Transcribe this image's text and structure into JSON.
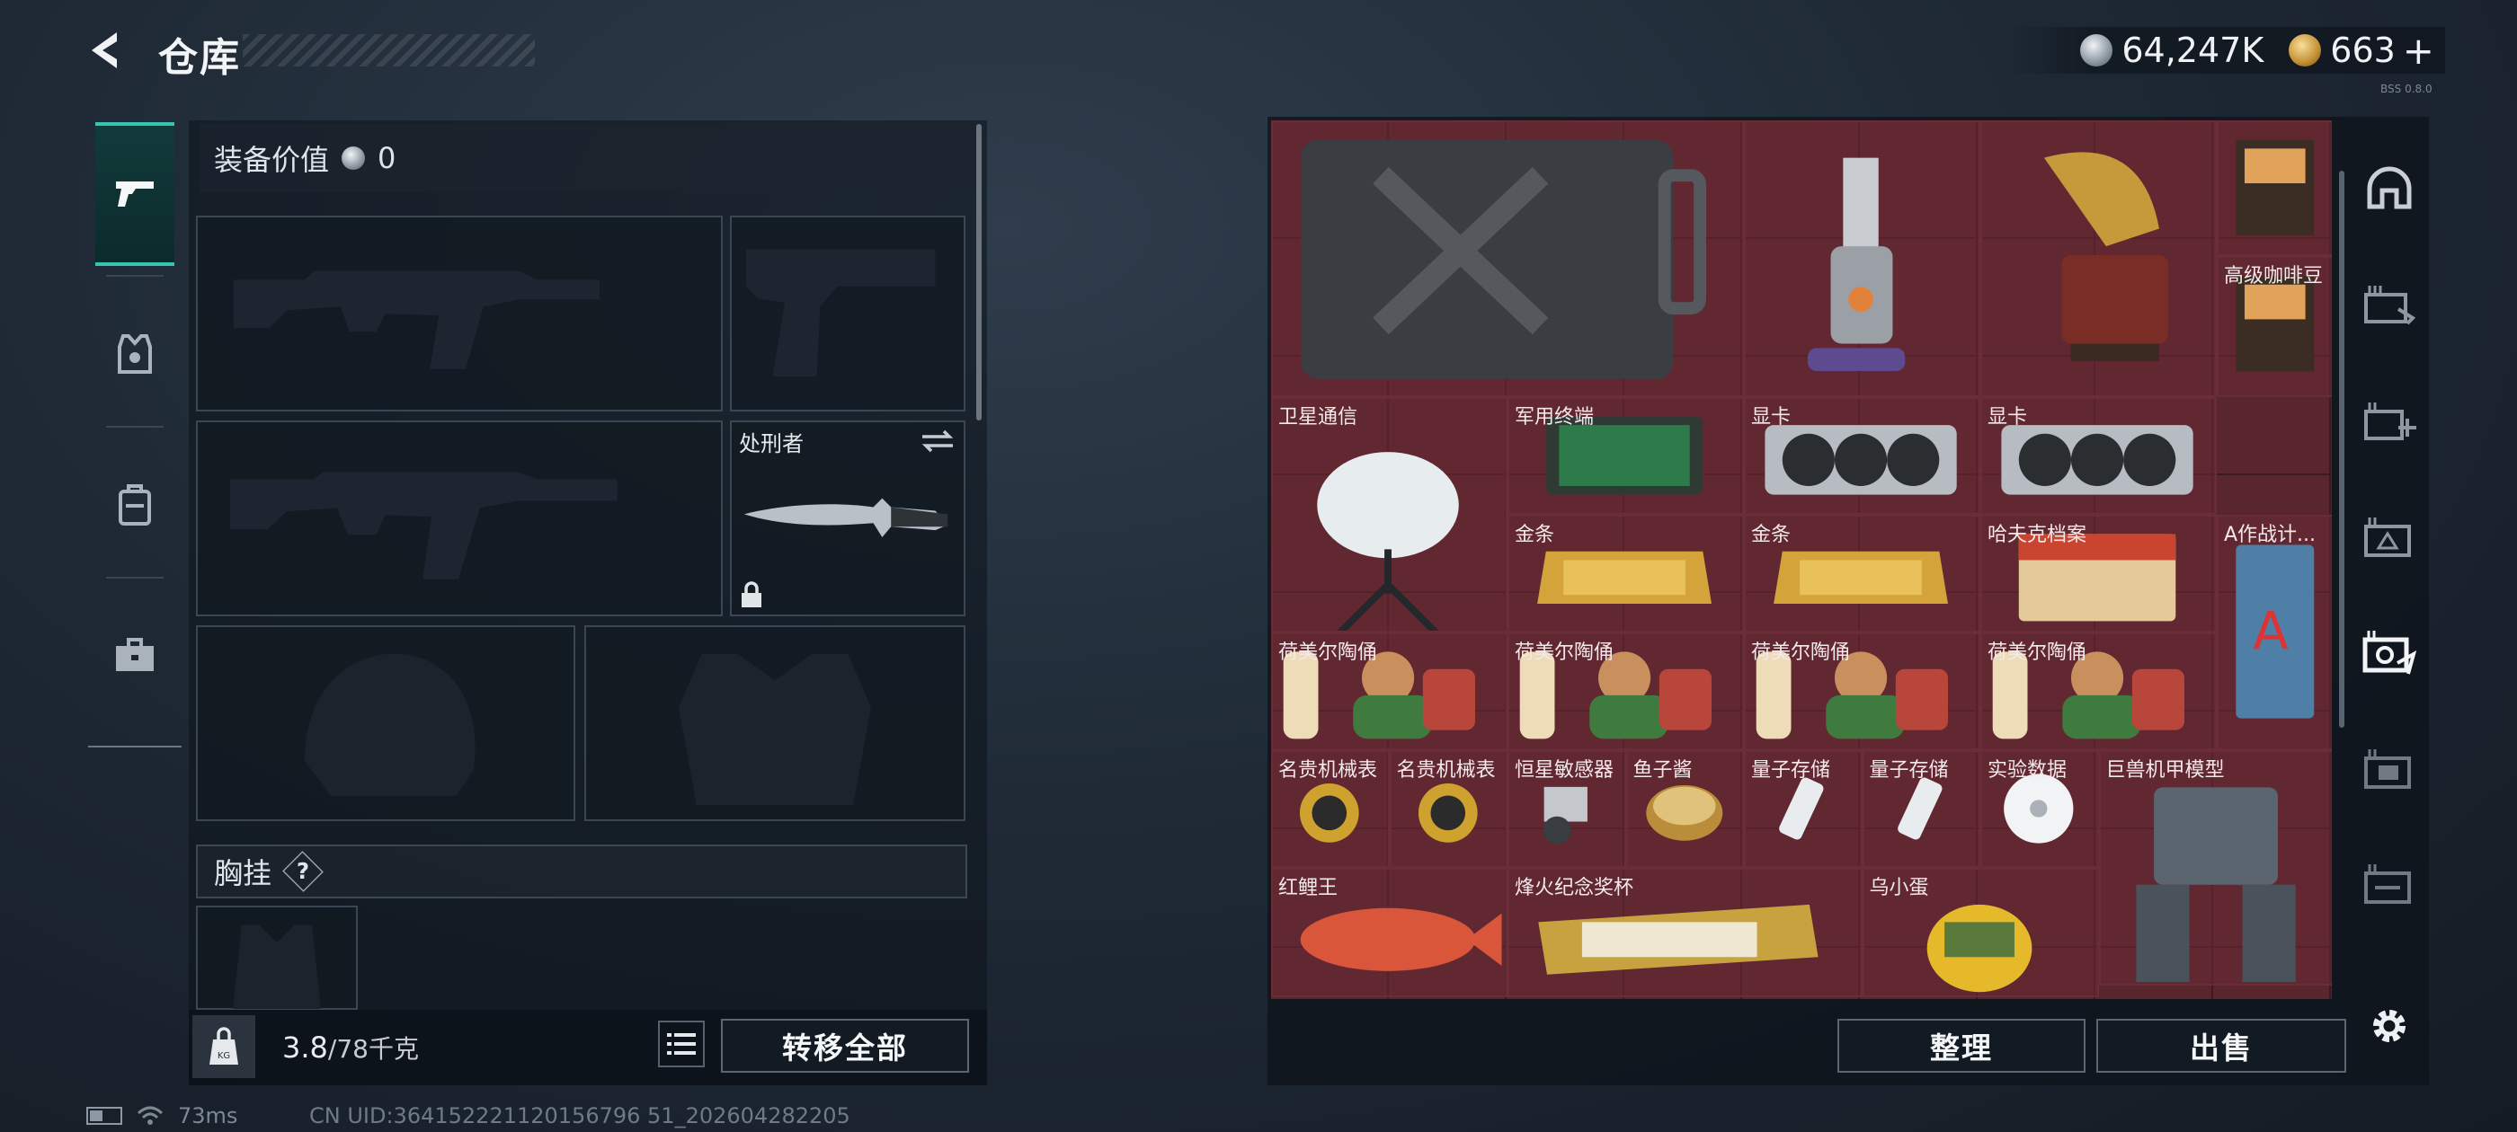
{
  "header": {
    "title": "仓库",
    "back_icon": "back-arrow-icon"
  },
  "currency": {
    "silver": "64,247K",
    "gold": "663",
    "plus": "+",
    "tiny": "BSS 0.8.0"
  },
  "left_nav": {
    "tabs": [
      {
        "icon": "pistol-icon",
        "active": true
      },
      {
        "icon": "armor-vest-icon"
      },
      {
        "icon": "backpack-icon"
      },
      {
        "icon": "briefcase-icon"
      }
    ]
  },
  "equipment": {
    "value_label": "装备价值",
    "value": "0",
    "slots": {
      "melee_label": "处刑者"
    },
    "chest_rig_label": "胸挂",
    "chest_rig_help": "?"
  },
  "footer_left": {
    "weight": "3.8",
    "capacity": "/78千克",
    "transfer_all": "转移全部"
  },
  "status": {
    "latency": "73ms",
    "uid": "CN UID:364152221120156796 51_202604282205"
  },
  "stash": {
    "items": [
      {
        "name": "",
        "icon": "jerrycan-icon"
      },
      {
        "name": "",
        "icon": "vacuum-icon"
      },
      {
        "name": "",
        "icon": "gramophone-icon"
      },
      {
        "name": "",
        "icon": "coffee-bag-icon"
      },
      {
        "name": "高级咖啡豆",
        "icon": "coffee-bag-icon"
      },
      {
        "name": "卫星通信",
        "icon": "satellite-dish-icon"
      },
      {
        "name": "军用终端",
        "icon": "circuit-board-icon"
      },
      {
        "name": "显卡",
        "icon": "gpu-icon"
      },
      {
        "name": "显卡",
        "icon": "gpu-icon"
      },
      {
        "name": "金条",
        "icon": "gold-bar-icon"
      },
      {
        "name": "金条",
        "icon": "gold-bar-icon"
      },
      {
        "name": "哈夫克档案",
        "icon": "folder-icon"
      },
      {
        "name": "A作战计...",
        "icon": "book-icon"
      },
      {
        "name": "荷美尔陶俑",
        "icon": "figurine-icon"
      },
      {
        "name": "荷美尔陶俑",
        "icon": "figurine-icon"
      },
      {
        "name": "荷美尔陶俑",
        "icon": "figurine-icon"
      },
      {
        "name": "荷美尔陶俑",
        "icon": "figurine-icon"
      },
      {
        "name": "名贵机械表",
        "icon": "watch-icon"
      },
      {
        "name": "名贵机械表",
        "icon": "watch-icon"
      },
      {
        "name": "恒星敏感器",
        "icon": "sensor-icon"
      },
      {
        "name": "鱼子酱",
        "icon": "caviar-icon"
      },
      {
        "name": "量子存储",
        "icon": "usb-icon"
      },
      {
        "name": "量子存储",
        "icon": "usb-icon"
      },
      {
        "name": "实验数据",
        "icon": "disc-icon"
      },
      {
        "name": "巨兽机甲模型",
        "icon": "mech-icon"
      },
      {
        "name": "红鲤王",
        "icon": "carp-icon"
      },
      {
        "name": "烽火纪念奖杯",
        "icon": "trophy-icon"
      },
      {
        "name": "乌小蛋",
        "icon": "egg-icon"
      }
    ],
    "sort_button": "整理",
    "sell_button": "出售"
  },
  "right_nav": {
    "tabs": [
      {
        "icon": "helmet-outline-icon"
      },
      {
        "icon": "ammo-crate-icon"
      },
      {
        "icon": "medical-crate-icon"
      },
      {
        "icon": "armor-crate-icon"
      },
      {
        "icon": "valuables-icon",
        "active": true
      },
      {
        "icon": "folder-crate-icon"
      },
      {
        "icon": "misc-crate-icon"
      }
    ],
    "settings": "gear-icon"
  },
  "colors": {
    "accent": "#34c6b0",
    "stash_bg": "#4b2229",
    "gold": "#c9a240"
  }
}
